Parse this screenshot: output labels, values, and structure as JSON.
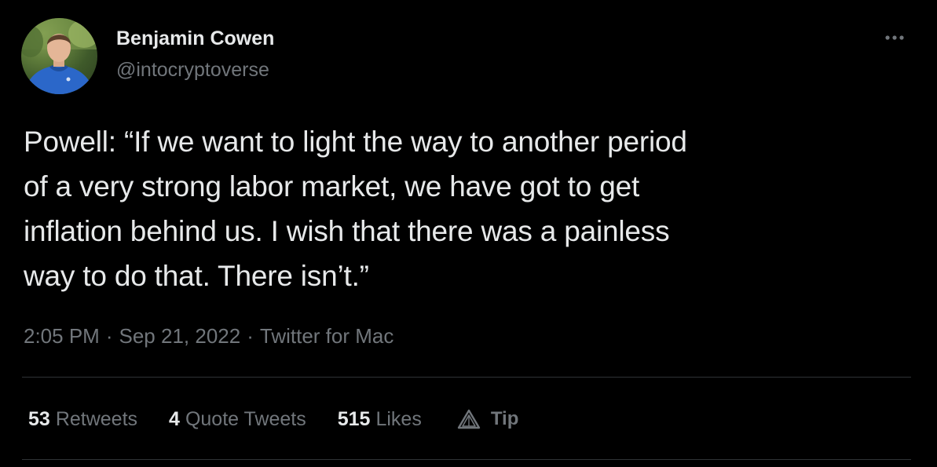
{
  "author": {
    "display_name": "Benjamin Cowen",
    "handle": "@intocryptoverse"
  },
  "tweet": {
    "text": "Powell: “If we want to light the way to another period\nof a very strong labor market, we have got to get\ninflation behind us. I wish that there was a painless\nway to do that. There isn’t.”",
    "time": "2:05 PM",
    "date": "Sep 21, 2022",
    "source": "Twitter for Mac",
    "separator": "·"
  },
  "stats": {
    "retweets": {
      "count": "53",
      "label": "Retweets"
    },
    "quote_tweets": {
      "count": "4",
      "label": "Quote Tweets"
    },
    "likes": {
      "count": "515",
      "label": "Likes"
    },
    "tip": {
      "label": "Tip",
      "icon": "tip-icon"
    }
  },
  "icons": {
    "more": "more-options-icon",
    "avatar": "avatar-image"
  },
  "colors": {
    "background": "#000000",
    "text_primary": "#e7e9ea",
    "text_secondary": "#71767b",
    "divider": "#2f3336"
  }
}
